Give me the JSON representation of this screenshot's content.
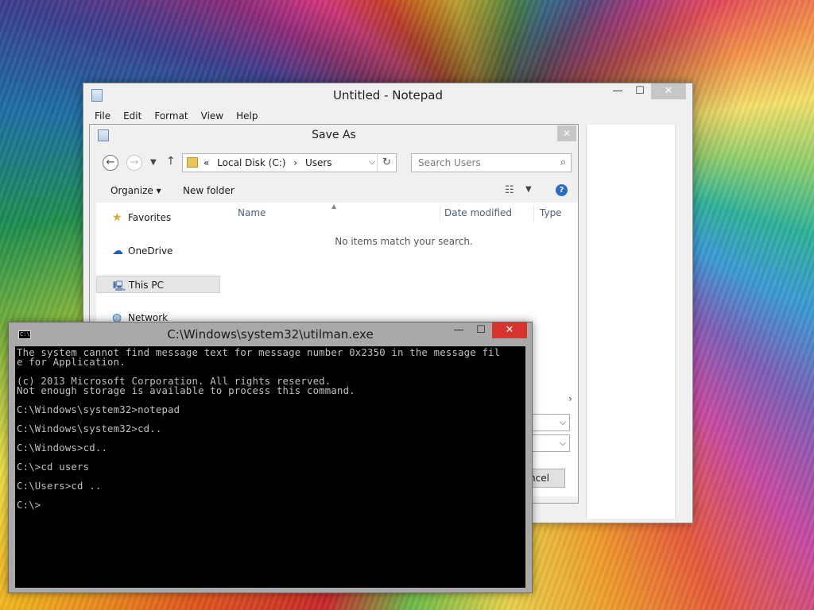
{
  "notepad": {
    "title": "Untitled - Notepad",
    "menu": [
      "File",
      "Edit",
      "Format",
      "View",
      "Help"
    ],
    "controls": {
      "minimize": "—",
      "maximize": "☐",
      "close": "✕"
    }
  },
  "save_as": {
    "title": "Save As",
    "close": "✕",
    "address": {
      "prefix": "«",
      "segments": [
        "Local Disk (C:)",
        "Users"
      ],
      "separator": "›"
    },
    "search_placeholder": "Search Users",
    "toolbar": {
      "organize": "Organize ▾",
      "new_folder": "New folder",
      "help": "?"
    },
    "nav_items": [
      {
        "label": "Favorites",
        "icon": "star-icon"
      },
      {
        "label": "OneDrive",
        "icon": "cloud-icon"
      },
      {
        "label": "This PC",
        "icon": "computer-icon",
        "selected": true
      },
      {
        "label": "Network",
        "icon": "network-icon"
      }
    ],
    "columns": [
      "Name",
      "Date modified",
      "Type"
    ],
    "empty_message": "No items match your search.",
    "cancel_label": "ncel"
  },
  "cmd": {
    "title": "C:\\Windows\\system32\\utilman.exe",
    "icon_text": "C:\\",
    "controls": {
      "minimize": "—",
      "maximize": "☐",
      "close": "✕"
    },
    "lines": [
      "The system cannot find message text for message number 0x2350 in the message fil",
      "e for Application.",
      "",
      "(c) 2013 Microsoft Corporation. All rights reserved.",
      "Not enough storage is available to process this command.",
      "",
      "C:\\Windows\\system32>notepad",
      "",
      "C:\\Windows\\system32>cd..",
      "",
      "C:\\Windows>cd..",
      "",
      "C:\\>cd users",
      "",
      "C:\\Users>cd ..",
      "",
      "C:\\>"
    ]
  }
}
